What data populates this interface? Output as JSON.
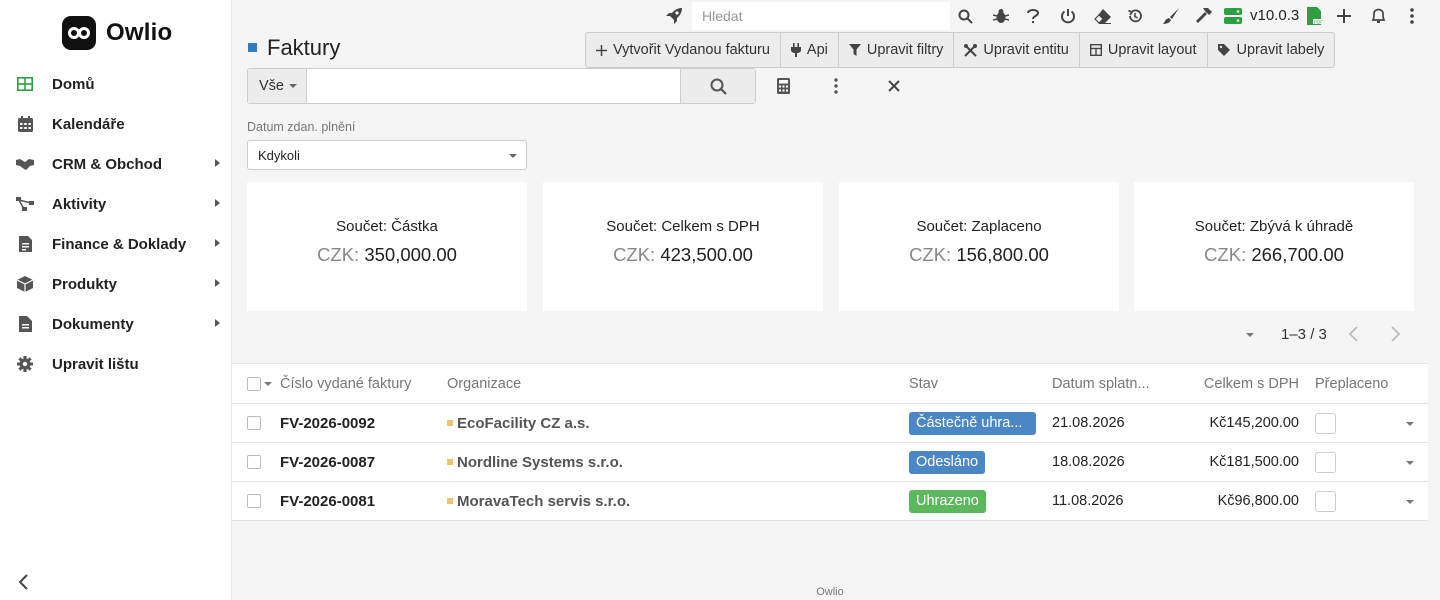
{
  "app": {
    "name": "Owlio",
    "version": "v10.0.3",
    "footer": "Owlio"
  },
  "topbar": {
    "search_placeholder": "Hledat"
  },
  "sidebar": {
    "items": [
      {
        "label": "Domů",
        "icon": "grid-icon",
        "has_submenu": false
      },
      {
        "label": "Kalendáře",
        "icon": "calendar-icon",
        "has_submenu": false
      },
      {
        "label": "CRM & Obchod",
        "icon": "handshake-icon",
        "has_submenu": true
      },
      {
        "label": "Aktivity",
        "icon": "activity-icon",
        "has_submenu": true
      },
      {
        "label": "Finance & Doklady",
        "icon": "receipt-icon",
        "has_submenu": true
      },
      {
        "label": "Produkty",
        "icon": "box-icon",
        "has_submenu": true
      },
      {
        "label": "Dokumenty",
        "icon": "document-icon",
        "has_submenu": true
      },
      {
        "label": "Upravit lištu",
        "icon": "gear-icon",
        "has_submenu": false
      }
    ]
  },
  "page": {
    "title": "Faktury"
  },
  "actions": {
    "create": "Vytvořit Vydanou fakturu",
    "api": "Api",
    "filters": "Upravit filtry",
    "entity": "Upravit entitu",
    "layout": "Upravit layout",
    "labels": "Upravit labely"
  },
  "search": {
    "scope": "Vše",
    "value": ""
  },
  "filter": {
    "label": "Datum zdan. plnění",
    "value": "Kdykoli"
  },
  "summary": [
    {
      "label": "Součet: Částka",
      "currency": "CZK:",
      "value": "350,000.00"
    },
    {
      "label": "Součet: Celkem s DPH",
      "currency": "CZK:",
      "value": "423,500.00"
    },
    {
      "label": "Součet: Zaplaceno",
      "currency": "CZK:",
      "value": "156,800.00"
    },
    {
      "label": "Součet: Zbývá k úhradě",
      "currency": "CZK:",
      "value": "266,700.00"
    }
  ],
  "pagination": {
    "range": "1–3 / 3"
  },
  "table": {
    "columns": {
      "number": "Číslo vydané faktury",
      "organization": "Organizace",
      "status": "Stav",
      "due_date": "Datum splatn...",
      "total": "Celkem s DPH",
      "overpaid": "Přeplaceno"
    },
    "rows": [
      {
        "number": "FV-2026-0092",
        "organization": "EcoFacility CZ a.s.",
        "status": "Částečně uhra...",
        "status_color": "#4b86c5",
        "due_date": "21.08.2026",
        "total": "Kč145,200.00",
        "overpaid": false
      },
      {
        "number": "FV-2026-0087",
        "organization": "Nordline Systems s.r.o.",
        "status": "Odesláno",
        "status_color": "#4b86c5",
        "due_date": "18.08.2026",
        "total": "Kč181,500.00",
        "overpaid": false
      },
      {
        "number": "FV-2026-0081",
        "organization": "MoravaTech servis s.r.o.",
        "status": "Uhrazeno",
        "status_color": "#5cb85c",
        "due_date": "11.08.2026",
        "total": "Kč96,800.00",
        "overpaid": false
      }
    ]
  }
}
